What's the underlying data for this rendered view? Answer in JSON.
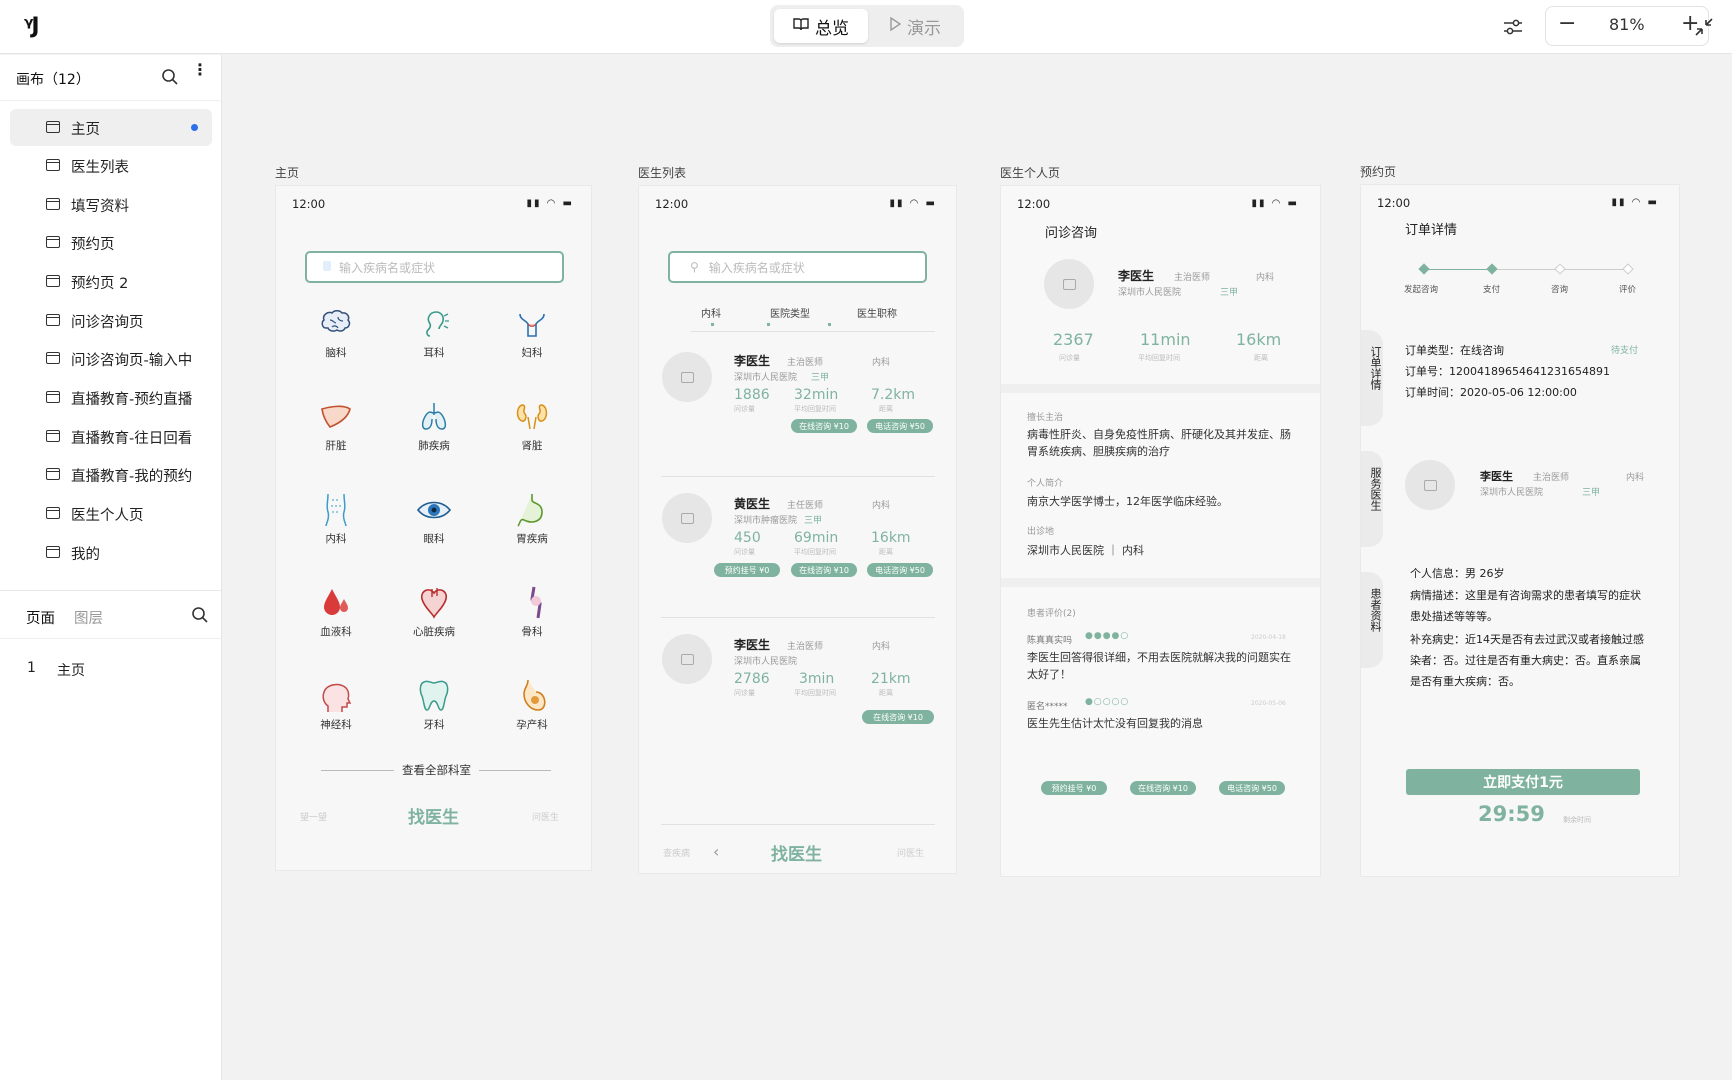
{
  "topbar": {
    "logo": "ᵞJ",
    "tab_overview": "总览",
    "tab_present": "演示",
    "zoom": "81%"
  },
  "sidebar": {
    "title": "画布（12）",
    "pages": [
      "主页",
      "医生列表",
      "填写资料",
      "预约页",
      "预约页 2",
      "问诊咨询页",
      "问诊咨询页-输入中",
      "直播教育-预约直播",
      "直播教育-往日回看",
      "直播教育-我的预约",
      "医生个人页",
      "我的"
    ],
    "tab_pages": "页面",
    "tab_layers": "图层",
    "layer_num": "1",
    "layer_name": "主页"
  },
  "frames": {
    "home": {
      "label": "主页",
      "time": "12:00",
      "search_placeholder": "输入疾病名或症状",
      "icons": [
        "脑科",
        "耳科",
        "妇科",
        "肝脏",
        "肺疾病",
        "肾脏",
        "内科",
        "眼科",
        "胃疾病",
        "血液科",
        "心脏疾病",
        "骨科",
        "神经科",
        "牙科",
        "孕产科"
      ],
      "all_depts": "查看全部科室",
      "nav_left": "望一望",
      "nav_center": "找医生",
      "nav_right": "问医生"
    },
    "doclist": {
      "label": "医生列表",
      "time": "12:00",
      "search_placeholder": "输入疾病名或症状",
      "filters": [
        "内科",
        "医院类型",
        "医生职称"
      ],
      "doctors": [
        {
          "name": "李医生",
          "title": "主治医师",
          "dept": "内科",
          "hospital": "深圳市人民医院",
          "level": "三甲",
          "s1": "1886",
          "s2": "32min",
          "s3": "7.2km",
          "l1": "问诊量",
          "l2": "平均回复时间",
          "l3": "距离",
          "b": [
            "在线咨询 ¥10",
            "电话咨询 ¥50"
          ]
        },
        {
          "name": "黄医生",
          "title": "主任医师",
          "dept": "内科",
          "hospital": "深圳市肿瘤医院",
          "level": "三甲",
          "s1": "450",
          "s2": "69min",
          "s3": "16km",
          "l1": "问诊量",
          "l2": "平均回复时间",
          "l3": "距离",
          "b": [
            "预约挂号 ¥0",
            "在线咨询 ¥10",
            "电话咨询 ¥50"
          ]
        },
        {
          "name": "李医生",
          "title": "主治医师",
          "dept": "内科",
          "hospital": "深圳市人民医院",
          "level": "",
          "s1": "2786",
          "s2": "3min",
          "s3": "21km",
          "l1": "问诊量",
          "l2": "平均回复时间",
          "l3": "距离",
          "b": [
            "在线咨询 ¥10"
          ]
        }
      ],
      "nav_left": "查疾病",
      "nav_center": "找医生",
      "nav_right": "问医生"
    },
    "docpage": {
      "label": "医生个人页",
      "time": "12:00",
      "header": "问诊咨询",
      "name": "李医生",
      "title": "主治医师",
      "dept": "内科",
      "hospital": "深圳市人民医院",
      "level": "三甲",
      "s1": "2367",
      "s2": "11min",
      "s3": "16km",
      "l1": "问诊量",
      "l2": "平均回复时间",
      "l3": "距离",
      "spec_label": "擅长主治",
      "spec": "病毒性肝炎、自身免疫性肝病、肝硬化及其并发症、肠胃系统疾病、胆胰疾病的治疗",
      "intro_label": "个人简介",
      "intro": "南京大学医学博士，12年医学临床经验。",
      "place_label": "出诊地",
      "place": "深圳市人民医院 ｜ 内科",
      "rev_label": "患者评价(2)",
      "r1_user": "陈真真实吗",
      "r1_date": "2020-04-18",
      "r1_text": "李医生回答得很详细，不用去医院就解决我的问题实在太好了！",
      "r2_user": "匿名*****",
      "r2_date": "2020-05-06",
      "r2_text": "医生先生估计太忙没有回复我的消息",
      "b": [
        "预约挂号 ¥0",
        "在线咨询 ¥10",
        "电话咨询 ¥50"
      ]
    },
    "booking": {
      "label": "预约页",
      "time": "12:00",
      "header": "订单详情",
      "steps": [
        "发起咨询",
        "支付",
        "咨询",
        "评价"
      ],
      "side1": "订单详情",
      "side2": "服务医生",
      "side3": "患者资料",
      "order_type": "订单类型：在线咨询",
      "order_status": "待支付",
      "order_no": "订单号：120041896546412316548​91",
      "order_time": "订单时间：2020-05-06  12:00:00",
      "name": "李医生",
      "title": "主治医师",
      "dept": "内科",
      "hospital": "深圳市人民医院",
      "level": "三甲",
      "p1": "个人信息：男 26岁",
      "p2": "病情描述：这里是有咨询需求的患者填写的症状患处描述等等等。",
      "p3": "补充病史：近14天是否有去过武汉或者接触过感染者：否。过往是否有重大病史：否。直系亲属是否有重大疾病：否。",
      "pay": "立即支付1元",
      "countdown": "29:59",
      "countdown_label": "剩余时间"
    }
  },
  "colors": {
    "accent": "#7fb3a0",
    "selected_dot": "#2c6fe8"
  }
}
